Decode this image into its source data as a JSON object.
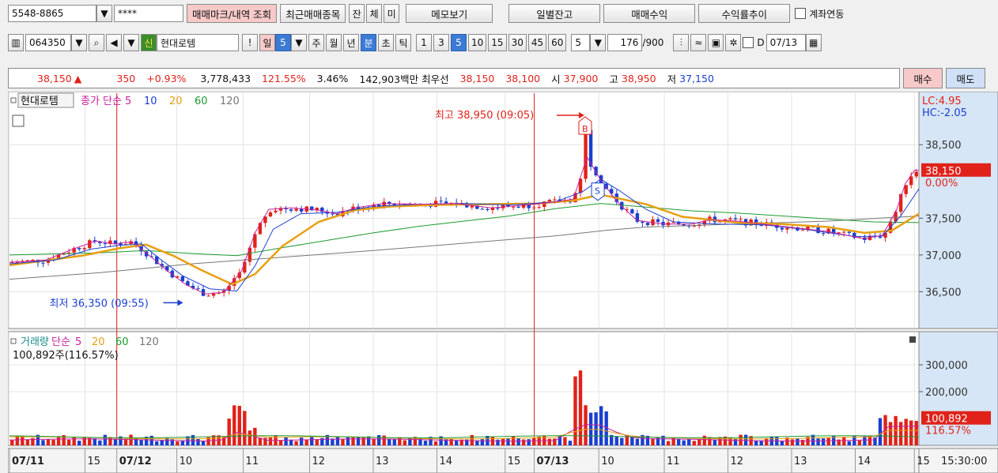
{
  "toolbar1": {
    "account": "5548-8865",
    "password": "****",
    "trade_mark_btn": "매매마크/내역 조회",
    "recent_btn": "최근매매종목",
    "btn_jan": "잔",
    "btn_che": "체",
    "btn_mi": "미",
    "memo_btn": "메모보기",
    "daily_btn": "일별잔고",
    "profit_btn": "매매수익",
    "yield_btn": "수익률추이",
    "link_label": "계좌연동"
  },
  "toolbar2": {
    "code": "064350",
    "badge": "신",
    "stock_name": "현대로템",
    "excl": "!",
    "period_day": "일",
    "period_num": "5",
    "week": "주",
    "month": "월",
    "year": "년",
    "minute": "분",
    "second": "초",
    "tick": "틱",
    "intervals": [
      "1",
      "3",
      "5",
      "10",
      "15",
      "30",
      "45",
      "60"
    ],
    "count_sel": "5",
    "count": "176",
    "count_total": "/900",
    "d_label": "D",
    "date": "07/13"
  },
  "quote": {
    "price": "38,150",
    "arrow": "▲",
    "change": "350",
    "change_pct": "+0.93%",
    "volume": "3,778,433",
    "vol_ratio": "121.55%",
    "turnover": "3.46%",
    "amount": "142,903백만",
    "best_label": "최우선",
    "ask": "38,150",
    "bid": "38,100",
    "open_label": "시",
    "open": "37,900",
    "high_label": "고",
    "high": "38,950",
    "low_label": "저",
    "low": "37,150",
    "buy_btn": "매수",
    "sell_btn": "매도"
  },
  "chart_data": {
    "type": "candlestick",
    "price_panel": {
      "legend": [
        {
          "text": "현대로템",
          "color": "#111111"
        },
        {
          "text": "종가 단순",
          "color": "#c8209b"
        },
        {
          "text": "5",
          "color": "#c8209b"
        },
        {
          "text": "10",
          "color": "#1a3fd0"
        },
        {
          "text": "20",
          "color": "#e6a012"
        },
        {
          "text": "60",
          "color": "#1f9a2e"
        },
        {
          "text": "120",
          "color": "#777777"
        }
      ],
      "ylim": [
        36000,
        39200
      ],
      "yticks": [
        36500,
        37000,
        37500,
        38500
      ],
      "ytick_labels": [
        "36,500",
        "37,000",
        "37,500",
        "38,500"
      ],
      "lc": "LC:4.95",
      "hc": "HC:-2.05",
      "last_price_label": "38,150",
      "last_pct_label": "0.00%",
      "high_annotation": "최고 38,950 (09:05)",
      "low_annotation": "최저 36,350 (09:55)",
      "buy_marker": "B",
      "sell_marker": "S",
      "ma5": [
        [
          0,
          36900
        ],
        [
          0.04,
          36930
        ],
        [
          0.07,
          37080
        ],
        [
          0.095,
          37190
        ],
        [
          0.115,
          37150
        ],
        [
          0.135,
          37180
        ],
        [
          0.155,
          36980
        ],
        [
          0.175,
          36770
        ],
        [
          0.195,
          36590
        ],
        [
          0.215,
          36470
        ],
        [
          0.235,
          36490
        ],
        [
          0.255,
          36780
        ],
        [
          0.27,
          37300
        ],
        [
          0.285,
          37620
        ],
        [
          0.31,
          37640
        ],
        [
          0.34,
          37610
        ],
        [
          0.36,
          37560
        ],
        [
          0.38,
          37640
        ],
        [
          0.41,
          37700
        ],
        [
          0.45,
          37690
        ],
        [
          0.49,
          37700
        ],
        [
          0.53,
          37640
        ],
        [
          0.57,
          37680
        ],
        [
          0.6,
          37720
        ],
        [
          0.62,
          37760
        ],
        [
          0.635,
          38330
        ],
        [
          0.65,
          38020
        ],
        [
          0.67,
          37700
        ],
        [
          0.69,
          37470
        ],
        [
          0.72,
          37420
        ],
        [
          0.75,
          37420
        ],
        [
          0.77,
          37480
        ],
        [
          0.8,
          37460
        ],
        [
          0.85,
          37390
        ],
        [
          0.9,
          37320
        ],
        [
          0.94,
          37220
        ],
        [
          0.96,
          37270
        ],
        [
          0.975,
          37600
        ],
        [
          0.985,
          37970
        ],
        [
          0.995,
          38150
        ],
        [
          1.0,
          38150
        ]
      ],
      "ma10": [
        [
          0,
          36880
        ],
        [
          0.05,
          36930
        ],
        [
          0.09,
          37080
        ],
        [
          0.12,
          37130
        ],
        [
          0.145,
          37150
        ],
        [
          0.165,
          36950
        ],
        [
          0.19,
          36720
        ],
        [
          0.22,
          36540
        ],
        [
          0.25,
          36510
        ],
        [
          0.27,
          36850
        ],
        [
          0.29,
          37350
        ],
        [
          0.32,
          37560
        ],
        [
          0.36,
          37580
        ],
        [
          0.4,
          37660
        ],
        [
          0.45,
          37690
        ],
        [
          0.5,
          37700
        ],
        [
          0.55,
          37680
        ],
        [
          0.6,
          37720
        ],
        [
          0.63,
          37860
        ],
        [
          0.65,
          38030
        ],
        [
          0.67,
          37880
        ],
        [
          0.7,
          37620
        ],
        [
          0.73,
          37450
        ],
        [
          0.78,
          37420
        ],
        [
          0.83,
          37410
        ],
        [
          0.88,
          37340
        ],
        [
          0.93,
          37250
        ],
        [
          0.96,
          37260
        ],
        [
          0.98,
          37530
        ],
        [
          1.0,
          37900
        ]
      ],
      "ma20": [
        [
          0,
          36860
        ],
        [
          0.08,
          36990
        ],
        [
          0.12,
          37090
        ],
        [
          0.15,
          37140
        ],
        [
          0.18,
          36990
        ],
        [
          0.21,
          36800
        ],
        [
          0.245,
          36600
        ],
        [
          0.27,
          36740
        ],
        [
          0.3,
          37120
        ],
        [
          0.34,
          37450
        ],
        [
          0.38,
          37610
        ],
        [
          0.42,
          37660
        ],
        [
          0.47,
          37680
        ],
        [
          0.52,
          37690
        ],
        [
          0.58,
          37700
        ],
        [
          0.62,
          37740
        ],
        [
          0.65,
          37820
        ],
        [
          0.7,
          37690
        ],
        [
          0.74,
          37520
        ],
        [
          0.8,
          37440
        ],
        [
          0.85,
          37420
        ],
        [
          0.9,
          37380
        ],
        [
          0.94,
          37300
        ],
        [
          0.97,
          37330
        ],
        [
          1.0,
          37560
        ]
      ],
      "ma60": [
        [
          0,
          37000
        ],
        [
          0.1,
          37030
        ],
        [
          0.15,
          37060
        ],
        [
          0.2,
          37020
        ],
        [
          0.25,
          36990
        ],
        [
          0.3,
          37100
        ],
        [
          0.35,
          37200
        ],
        [
          0.4,
          37300
        ],
        [
          0.45,
          37390
        ],
        [
          0.5,
          37460
        ],
        [
          0.55,
          37530
        ],
        [
          0.6,
          37630
        ],
        [
          0.65,
          37700
        ],
        [
          0.7,
          37650
        ],
        [
          0.75,
          37600
        ],
        [
          0.8,
          37570
        ],
        [
          0.85,
          37530
        ],
        [
          0.9,
          37490
        ],
        [
          0.95,
          37450
        ],
        [
          1.0,
          37440
        ]
      ],
      "ma120": [
        [
          0,
          36670
        ],
        [
          0.1,
          36760
        ],
        [
          0.2,
          36880
        ],
        [
          0.3,
          36970
        ],
        [
          0.4,
          37060
        ],
        [
          0.5,
          37160
        ],
        [
          0.6,
          37260
        ],
        [
          0.66,
          37340
        ],
        [
          0.7,
          37380
        ],
        [
          0.8,
          37420
        ],
        [
          0.9,
          37460
        ],
        [
          1.0,
          37530
        ]
      ]
    },
    "volume_panel": {
      "legend": [
        {
          "text": "거래량",
          "color": "#1a8a8a"
        },
        {
          "text": "단순",
          "color": "#c8209b"
        },
        {
          "text": "5",
          "color": "#c8209b"
        },
        {
          "text": "20",
          "color": "#e6a012"
        },
        {
          "text": "60",
          "color": "#1f9a2e"
        },
        {
          "text": "120",
          "color": "#777777"
        }
      ],
      "current_label": "100,892주(116.57%)",
      "ylim": [
        0,
        400000
      ],
      "yticks": [
        200000,
        300000
      ],
      "ytick_labels": [
        "200,000",
        "300,000"
      ],
      "last_volume_label": "100,892",
      "last_pct_label": "116.57%"
    },
    "xaxis": {
      "labels": [
        {
          "pos": 0.0,
          "text": "07/11",
          "bold": true
        },
        {
          "pos": 0.083,
          "text": "15",
          "bold": false
        },
        {
          "pos": 0.118,
          "text": "07/12",
          "bold": true
        },
        {
          "pos": 0.184,
          "text": "10",
          "bold": false
        },
        {
          "pos": 0.257,
          "text": "11",
          "bold": false
        },
        {
          "pos": 0.33,
          "text": "12",
          "bold": false
        },
        {
          "pos": 0.4,
          "text": "13",
          "bold": false
        },
        {
          "pos": 0.47,
          "text": "14",
          "bold": false
        },
        {
          "pos": 0.545,
          "text": "15",
          "bold": false
        },
        {
          "pos": 0.577,
          "text": "07/13",
          "bold": true
        },
        {
          "pos": 0.648,
          "text": "10",
          "bold": false
        },
        {
          "pos": 0.72,
          "text": "11",
          "bold": false
        },
        {
          "pos": 0.79,
          "text": "12",
          "bold": false
        },
        {
          "pos": 0.86,
          "text": "13",
          "bold": false
        },
        {
          "pos": 0.93,
          "text": "14",
          "bold": false
        },
        {
          "pos": 0.995,
          "text": "15",
          "bold": false
        }
      ],
      "time_label": "15:30:00"
    },
    "day_separators": [
      0.118,
      0.577
    ]
  },
  "colors": {
    "up": "#e0221a",
    "down": "#1a3fd0",
    "ma5": "#c8209b",
    "ma10": "#1a3fd0",
    "ma20": "#e6a012",
    "ma60": "#1f9a2e",
    "ma120": "#777777",
    "axis_bg": "#d6e6f6"
  }
}
